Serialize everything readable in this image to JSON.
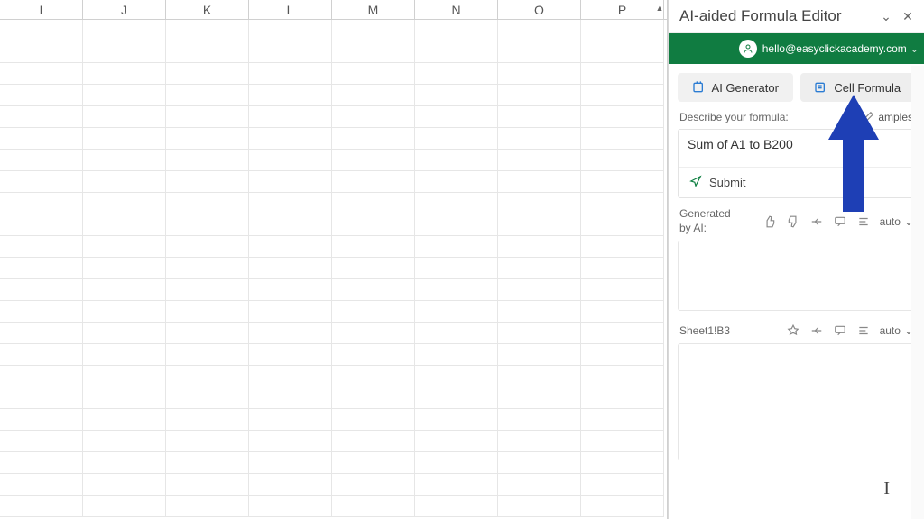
{
  "spreadsheet": {
    "columns": [
      "I",
      "J",
      "K",
      "L",
      "M",
      "N",
      "O",
      "P"
    ]
  },
  "panel": {
    "title": "AI-aided Formula Editor",
    "account_email": "hello@easyclickacademy.com",
    "tabs": {
      "generator": "AI Generator",
      "cell_formula": "Cell Formula"
    },
    "describe_label": "Describe your formula:",
    "examples_label": "amples",
    "input_value": "Sum of A1 to B200",
    "submit_label": "Submit",
    "generated_label_1": "Generated",
    "generated_label_2": "by AI:",
    "auto_label": "auto",
    "cell_ref": "Sheet1!B3"
  }
}
